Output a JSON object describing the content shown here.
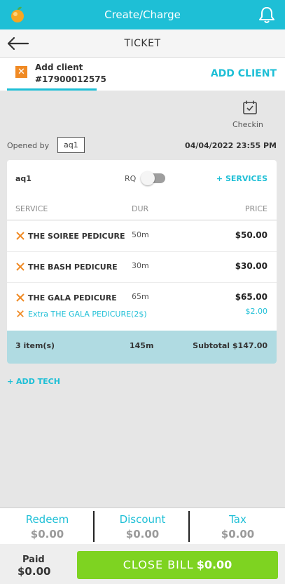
{
  "header": {
    "title": "Create/Charge",
    "logo_icon": "orange-logo-icon",
    "bell_icon": "bell-icon",
    "color": "#1ebfd6"
  },
  "ticket_bar": {
    "title": "TICKET",
    "back_icon": "arrow-left-icon"
  },
  "client": {
    "label": "Add client",
    "number": "#17900012575",
    "add_button": "ADD CLIENT",
    "accent": "#f08a24"
  },
  "checkin": {
    "label": "Checkin",
    "icon": "calendar-check-icon"
  },
  "opened": {
    "label": "Opened by",
    "value": "aq1",
    "datetime": "04/04/2022 23:55 PM"
  },
  "tech": {
    "name": "aq1",
    "rq_label": "RQ",
    "rq_on": false,
    "add_services": "+ SERVICES"
  },
  "columns": {
    "service": "SERVICE",
    "dur": "DUR",
    "price": "PRICE"
  },
  "services": [
    {
      "name": "THE SOIREE PEDICURE",
      "dur": "50m",
      "price": "$50.00"
    },
    {
      "name": "THE BASH PEDICURE",
      "dur": "30m",
      "price": "$30.00"
    },
    {
      "name": "THE GALA PEDICURE",
      "dur": "65m",
      "price": "$65.00"
    }
  ],
  "extra": {
    "name": "Extra THE GALA PEDICURE(2$)",
    "price": "$2.00"
  },
  "summary": {
    "items": "3 item(s)",
    "duration": "145m",
    "subtotal": "Subtotal $147.00"
  },
  "add_tech": "+ ADD TECH",
  "bottom": {
    "redeem": {
      "label": "Redeem",
      "value": "$0.00"
    },
    "discount": {
      "label": "Discount",
      "value": "$0.00"
    },
    "tax": {
      "label": "Tax",
      "value": "$0.00"
    }
  },
  "pay": {
    "paid_label": "Paid",
    "paid_value": "$0.00",
    "close_label": "CLOSE BILL",
    "close_amount": "$0.00",
    "button_color": "#7ed321"
  }
}
